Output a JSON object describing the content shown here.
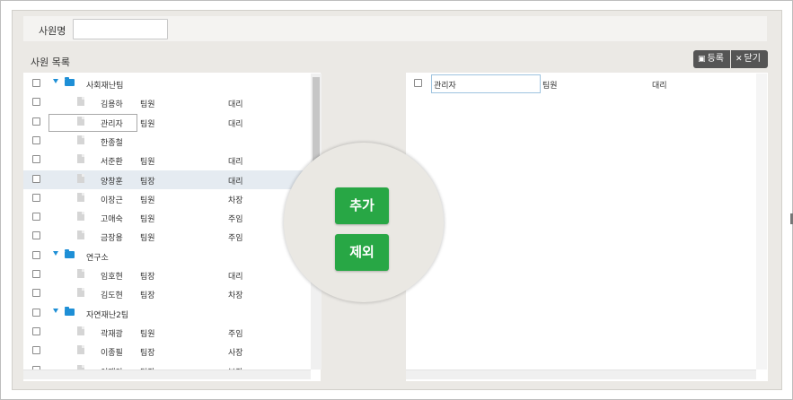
{
  "search": {
    "label": "사원명",
    "value": ""
  },
  "left": {
    "title": "사원 목록",
    "rows": [
      {
        "type": "team",
        "name": "사회재난팀"
      },
      {
        "type": "member",
        "name": "김용하",
        "role": "팀원",
        "position": "대리"
      },
      {
        "type": "member",
        "name": "관리자",
        "role": "팀원",
        "position": "대리",
        "focused": true
      },
      {
        "type": "member",
        "name": "한종철",
        "role": "",
        "position": ""
      },
      {
        "type": "member",
        "name": "서준환",
        "role": "팀원",
        "position": "대리"
      },
      {
        "type": "member",
        "name": "양창훈",
        "role": "팀장",
        "position": "대리",
        "highlighted": true
      },
      {
        "type": "member",
        "name": "이장근",
        "role": "팀원",
        "position": "차장"
      },
      {
        "type": "member",
        "name": "고애숙",
        "role": "팀원",
        "position": "주임"
      },
      {
        "type": "member",
        "name": "금장용",
        "role": "팀원",
        "position": "주임"
      },
      {
        "type": "team",
        "name": "연구소"
      },
      {
        "type": "member",
        "name": "임호현",
        "role": "팀장",
        "position": "대리"
      },
      {
        "type": "member",
        "name": "김도현",
        "role": "팀장",
        "position": "차장"
      },
      {
        "type": "team",
        "name": "자연재난2팀"
      },
      {
        "type": "member",
        "name": "곽재광",
        "role": "팀원",
        "position": "주임"
      },
      {
        "type": "member",
        "name": "이종필",
        "role": "팀장",
        "position": "사장"
      },
      {
        "type": "member",
        "name": "이재안",
        "role": "팀장",
        "position": "부장"
      }
    ]
  },
  "toolbar": {
    "register_label": "등록",
    "close_label": "닫기"
  },
  "actions": {
    "add_label": "추가",
    "remove_label": "제외"
  },
  "right": {
    "rows": [
      {
        "name": "관리자",
        "role": "팀원",
        "position": "대리"
      }
    ]
  },
  "colors": {
    "accent_green": "#28a745",
    "tree_blue": "#1e8fd6",
    "toolbar_dark": "#555555",
    "highlight_row": "#e5ebf1"
  },
  "icons": {
    "team": "folder-icon",
    "member": "document-icon",
    "expand": "triangle-down-icon",
    "register": "save-icon",
    "close": "x-icon"
  }
}
